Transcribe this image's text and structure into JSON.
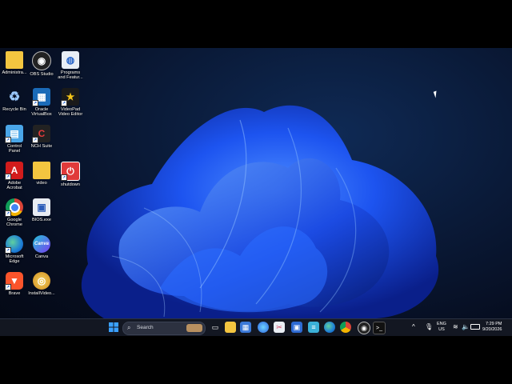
{
  "desktop": {
    "icons": [
      {
        "label": "Administra...",
        "icon": "folder-icon"
      },
      {
        "label": "OBS Studio",
        "icon": "obs-studio-icon"
      },
      {
        "label": "Programs\nand Featur...",
        "icon": "programs-and-features-icon"
      },
      {
        "label": "Recycle Bin",
        "icon": "recycle-bin-icon"
      },
      {
        "label": "Oracle\nVirtualBox",
        "icon": "virtualbox-icon"
      },
      {
        "label": "VideoPad\nVideo Editor",
        "icon": "videopad-icon"
      },
      {
        "label": "Control\nPanel",
        "icon": "control-panel-icon"
      },
      {
        "label": "NCH Suite",
        "icon": "nch-suite-icon"
      },
      {
        "label": "Adobe\nAcrobat",
        "icon": "adobe-acrobat-icon"
      },
      {
        "label": "video",
        "icon": "folder-icon"
      },
      {
        "label": "shutdown",
        "icon": "shutdown-icon"
      },
      {
        "label": "Google\nChrome",
        "icon": "chrome-icon"
      },
      {
        "label": "BIOS.exe",
        "icon": "bios-exe-icon"
      },
      {
        "label": "Microsoft\nEdge",
        "icon": "edge-icon"
      },
      {
        "label": "Canva",
        "icon": "canva-icon"
      },
      {
        "label": "Brave",
        "icon": "brave-icon"
      },
      {
        "label": "InstallVideo...",
        "icon": "install-video-icon"
      }
    ]
  },
  "taskbar": {
    "search_placeholder": "Search",
    "pinned": [
      "windows-start-icon",
      "task-view-icon",
      "file-explorer-icon",
      "microsoft-store-icon",
      "copilot-icon",
      "snipping-tool-icon",
      "remote-desktop-icon",
      "notepad-icon",
      "edge-icon",
      "chrome-icon",
      "obs-studio-icon",
      "terminal-icon"
    ],
    "tray": {
      "language": "ENG",
      "region": "US",
      "time": "7:29 PM",
      "date": "9/20/2026"
    }
  },
  "colors": {
    "wallpaper_accent": "#1e5cff",
    "taskbar_bg": "#141822"
  }
}
